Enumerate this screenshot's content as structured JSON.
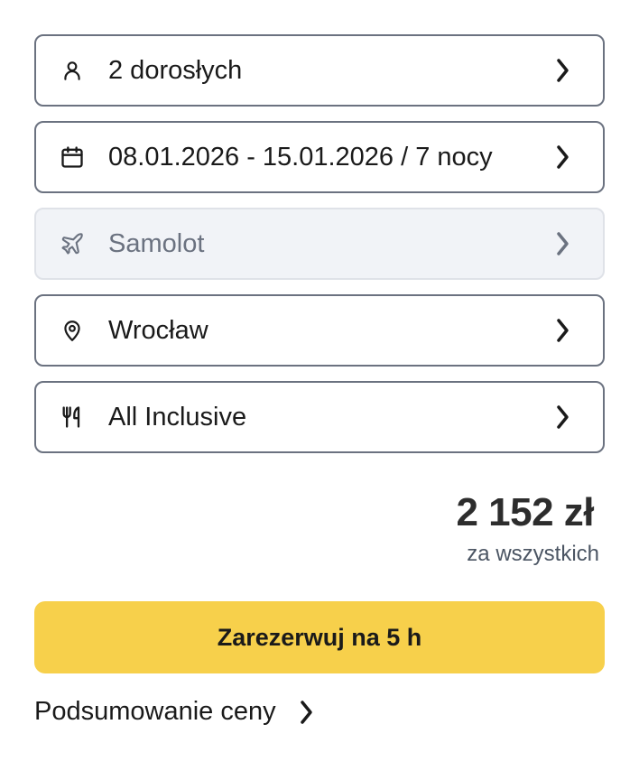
{
  "options": [
    {
      "label": "2 dorosłych",
      "icon": "person-icon",
      "disabled": false
    },
    {
      "label": "08.01.2026 - 15.01.2026 / 7 nocy",
      "icon": "calendar-icon",
      "disabled": false
    },
    {
      "label": "Samolot",
      "icon": "airplane-icon",
      "disabled": true
    },
    {
      "label": "Wrocław",
      "icon": "location-pin-icon",
      "disabled": false
    },
    {
      "label": "All Inclusive",
      "icon": "fork-knife-icon",
      "disabled": false
    }
  ],
  "price": {
    "value": "2 152 zł",
    "caption": "za wszystkich"
  },
  "book_button": {
    "label": "Zarezerwuj na 5 h",
    "color": "#f7d04b"
  },
  "summary_link": {
    "label": "Podsumowanie ceny"
  },
  "colors": {
    "border": "#6b7280",
    "disabled_bg": "#f1f3f7",
    "text": "#1a1a1a",
    "muted": "#6b7280"
  }
}
